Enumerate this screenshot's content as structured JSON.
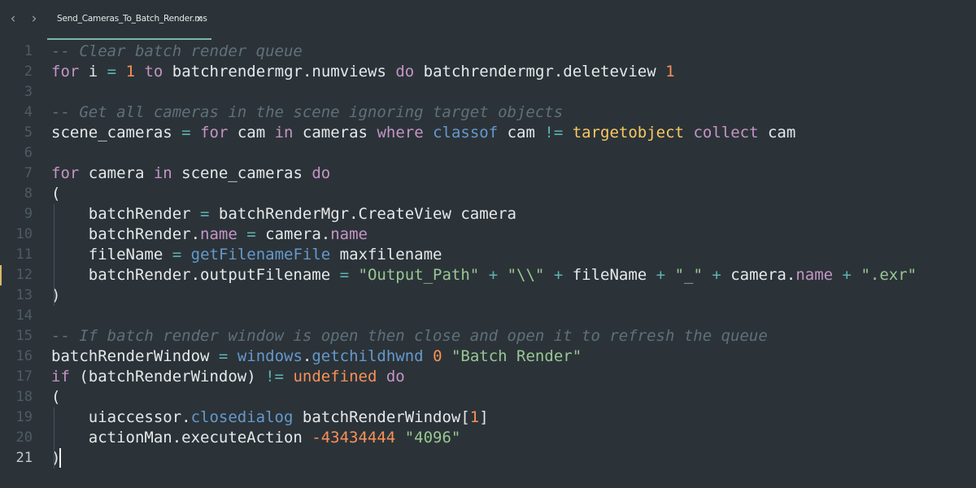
{
  "tab": {
    "nav_back": "‹",
    "nav_forward": "›",
    "title": "Send_Cameras_To_Batch_Render.ms",
    "close": "×",
    "accent_color": "#7fb5a8"
  },
  "editor": {
    "current_line": 21,
    "modified_line": 12,
    "lines": [
      {
        "num": "1",
        "tokens": [
          {
            "t": "-- Clear batch render queue",
            "c": "cm"
          }
        ]
      },
      {
        "num": "2",
        "tokens": [
          {
            "t": "for",
            "c": "kw"
          },
          {
            "t": " i ",
            "c": "tx"
          },
          {
            "t": "=",
            "c": "op"
          },
          {
            "t": " ",
            "c": "tx"
          },
          {
            "t": "1",
            "c": "nm"
          },
          {
            "t": " ",
            "c": "tx"
          },
          {
            "t": "to",
            "c": "kw"
          },
          {
            "t": " batchrendermgr.numviews ",
            "c": "tx"
          },
          {
            "t": "do",
            "c": "kw"
          },
          {
            "t": " batchrendermgr.deleteview ",
            "c": "tx"
          },
          {
            "t": "1",
            "c": "nm"
          }
        ]
      },
      {
        "num": "3",
        "tokens": []
      },
      {
        "num": "4",
        "tokens": [
          {
            "t": "-- Get all cameras in the scene ignoring target objects",
            "c": "cm"
          }
        ]
      },
      {
        "num": "5",
        "tokens": [
          {
            "t": "scene_cameras ",
            "c": "tx"
          },
          {
            "t": "=",
            "c": "op"
          },
          {
            "t": " ",
            "c": "tx"
          },
          {
            "t": "for",
            "c": "kw"
          },
          {
            "t": " cam ",
            "c": "tx"
          },
          {
            "t": "in",
            "c": "kw"
          },
          {
            "t": " cameras ",
            "c": "tx"
          },
          {
            "t": "where",
            "c": "kw"
          },
          {
            "t": " ",
            "c": "tx"
          },
          {
            "t": "classof",
            "c": "fn"
          },
          {
            "t": " cam ",
            "c": "tx"
          },
          {
            "t": "!=",
            "c": "op"
          },
          {
            "t": " ",
            "c": "tx"
          },
          {
            "t": "targetobject",
            "c": "cl"
          },
          {
            "t": " ",
            "c": "tx"
          },
          {
            "t": "collect",
            "c": "kw"
          },
          {
            "t": " cam",
            "c": "tx"
          }
        ]
      },
      {
        "num": "6",
        "tokens": []
      },
      {
        "num": "7",
        "tokens": [
          {
            "t": "for",
            "c": "kw"
          },
          {
            "t": " camera ",
            "c": "tx"
          },
          {
            "t": "in",
            "c": "kw"
          },
          {
            "t": " scene_cameras ",
            "c": "tx"
          },
          {
            "t": "do",
            "c": "kw"
          }
        ]
      },
      {
        "num": "8",
        "tokens": [
          {
            "t": "(",
            "c": "tx"
          }
        ]
      },
      {
        "num": "9",
        "tokens": [
          {
            "t": "    batchRender ",
            "c": "tx"
          },
          {
            "t": "=",
            "c": "op"
          },
          {
            "t": " batchRenderMgr.CreateView camera",
            "c": "tx"
          }
        ]
      },
      {
        "num": "10",
        "tokens": [
          {
            "t": "    batchRender.",
            "c": "tx"
          },
          {
            "t": "name",
            "c": "pr"
          },
          {
            "t": " ",
            "c": "tx"
          },
          {
            "t": "=",
            "c": "op"
          },
          {
            "t": " camera.",
            "c": "tx"
          },
          {
            "t": "name",
            "c": "pr"
          }
        ]
      },
      {
        "num": "11",
        "tokens": [
          {
            "t": "    fileName ",
            "c": "tx"
          },
          {
            "t": "=",
            "c": "op"
          },
          {
            "t": " ",
            "c": "tx"
          },
          {
            "t": "getFilenameFile",
            "c": "fn"
          },
          {
            "t": " maxfilename",
            "c": "tx"
          }
        ]
      },
      {
        "num": "12",
        "tokens": [
          {
            "t": "    batchRender.outputFilename ",
            "c": "tx"
          },
          {
            "t": "=",
            "c": "op"
          },
          {
            "t": " ",
            "c": "tx"
          },
          {
            "t": "\"Output_Path\"",
            "c": "st"
          },
          {
            "t": " ",
            "c": "tx"
          },
          {
            "t": "+",
            "c": "op"
          },
          {
            "t": " ",
            "c": "tx"
          },
          {
            "t": "\"\\\\\"",
            "c": "st"
          },
          {
            "t": " ",
            "c": "tx"
          },
          {
            "t": "+",
            "c": "op"
          },
          {
            "t": " fileName ",
            "c": "tx"
          },
          {
            "t": "+",
            "c": "op"
          },
          {
            "t": " ",
            "c": "tx"
          },
          {
            "t": "\"_\"",
            "c": "st"
          },
          {
            "t": " ",
            "c": "tx"
          },
          {
            "t": "+",
            "c": "op"
          },
          {
            "t": " camera.",
            "c": "tx"
          },
          {
            "t": "name",
            "c": "pr"
          },
          {
            "t": " ",
            "c": "tx"
          },
          {
            "t": "+",
            "c": "op"
          },
          {
            "t": " ",
            "c": "tx"
          },
          {
            "t": "\".exr\"",
            "c": "st"
          }
        ]
      },
      {
        "num": "13",
        "tokens": [
          {
            "t": ")",
            "c": "tx"
          }
        ]
      },
      {
        "num": "14",
        "tokens": []
      },
      {
        "num": "15",
        "tokens": [
          {
            "t": "-- If batch render window is open then close and open it to refresh the queue",
            "c": "cm"
          }
        ]
      },
      {
        "num": "16",
        "tokens": [
          {
            "t": "batchRenderWindow ",
            "c": "tx"
          },
          {
            "t": "=",
            "c": "op"
          },
          {
            "t": " ",
            "c": "tx"
          },
          {
            "t": "windows",
            "c": "fn"
          },
          {
            "t": ".",
            "c": "tx"
          },
          {
            "t": "getchildhwnd",
            "c": "fn"
          },
          {
            "t": " ",
            "c": "tx"
          },
          {
            "t": "0",
            "c": "nm"
          },
          {
            "t": " ",
            "c": "tx"
          },
          {
            "t": "\"Batch Render\"",
            "c": "st"
          }
        ]
      },
      {
        "num": "17",
        "tokens": [
          {
            "t": "if",
            "c": "kw"
          },
          {
            "t": " (batchRenderWindow) ",
            "c": "tx"
          },
          {
            "t": "!=",
            "c": "op"
          },
          {
            "t": " ",
            "c": "tx"
          },
          {
            "t": "undefined",
            "c": "nm"
          },
          {
            "t": " ",
            "c": "tx"
          },
          {
            "t": "do",
            "c": "kw"
          }
        ]
      },
      {
        "num": "18",
        "tokens": [
          {
            "t": "(",
            "c": "tx"
          }
        ]
      },
      {
        "num": "19",
        "tokens": [
          {
            "t": "    uiaccessor.",
            "c": "tx"
          },
          {
            "t": "closedialog",
            "c": "fn"
          },
          {
            "t": " batchRenderWindow[",
            "c": "tx"
          },
          {
            "t": "1",
            "c": "nm"
          },
          {
            "t": "]",
            "c": "tx"
          }
        ]
      },
      {
        "num": "20",
        "tokens": [
          {
            "t": "    actionMan.executeAction ",
            "c": "tx"
          },
          {
            "t": "-43434444",
            "c": "nm"
          },
          {
            "t": " ",
            "c": "tx"
          },
          {
            "t": "\"4096\"",
            "c": "st"
          }
        ]
      },
      {
        "num": "21",
        "tokens": [
          {
            "t": ")",
            "c": "tx"
          }
        ]
      }
    ]
  }
}
